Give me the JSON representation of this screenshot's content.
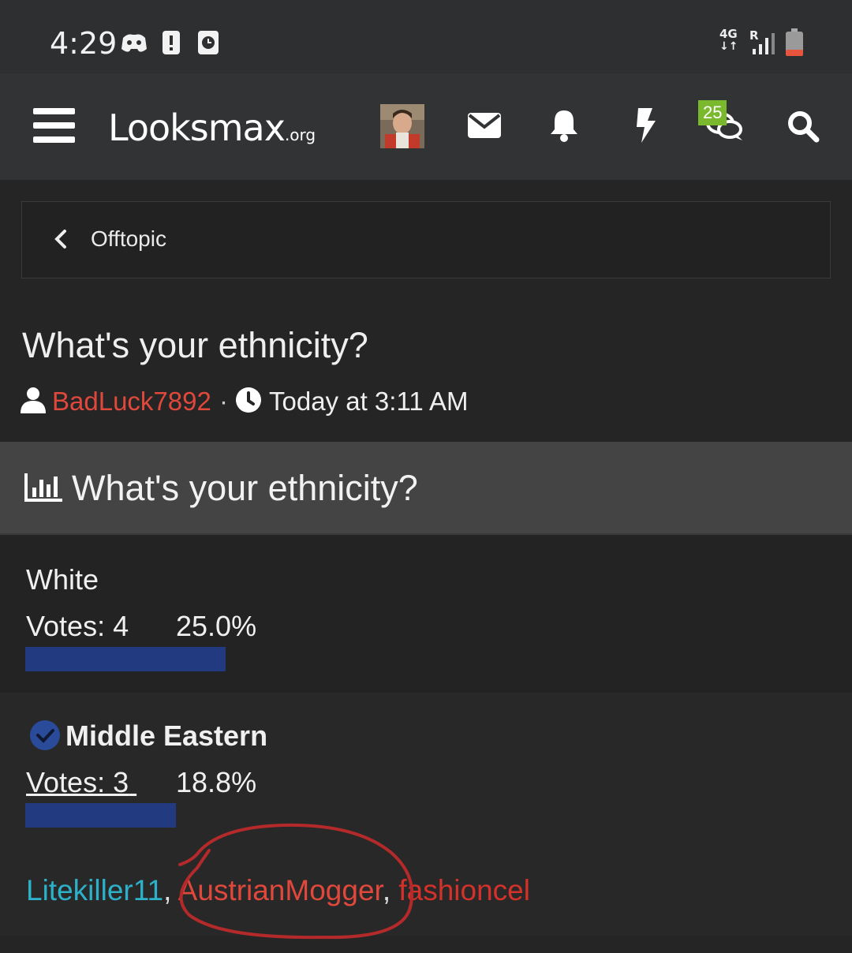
{
  "status_bar": {
    "time": "4:29",
    "network": "4G",
    "roaming": "R",
    "icons": [
      "discord-icon",
      "alert-icon",
      "clock-app-icon",
      "signal-icon",
      "battery-icon"
    ]
  },
  "navbar": {
    "logo_main": "Looksmax",
    "logo_suffix": ".org",
    "chat_badge": "25",
    "icons": [
      "menu-icon",
      "avatar",
      "envelope-icon",
      "bell-icon",
      "bolt-icon",
      "chat-icon",
      "search-icon"
    ]
  },
  "breadcrumb": {
    "label": "Offtopic"
  },
  "thread": {
    "title": "What's your ethnicity?",
    "author": "BadLuck7892",
    "separator": "·",
    "date": "Today at 3:11 AM"
  },
  "poll": {
    "title": "What's your ethnicity?",
    "options": [
      {
        "label": "White",
        "votes": "Votes: 4",
        "percent": "25.0%",
        "percent_value": 25.0
      },
      {
        "label": "Middle Eastern",
        "votes": "Votes: 3",
        "percent": "18.8%",
        "percent_value": 18.8,
        "voted": true
      }
    ],
    "voters": [
      "Litekiller11",
      "AustrianMogger",
      "fashioncel"
    ],
    "voter_separator": ", "
  },
  "colors": {
    "accent_red": "#e0483c",
    "voter_blue": "#2cb1c9",
    "bar_blue": "#213a80",
    "badge_green": "#7ab82e"
  }
}
